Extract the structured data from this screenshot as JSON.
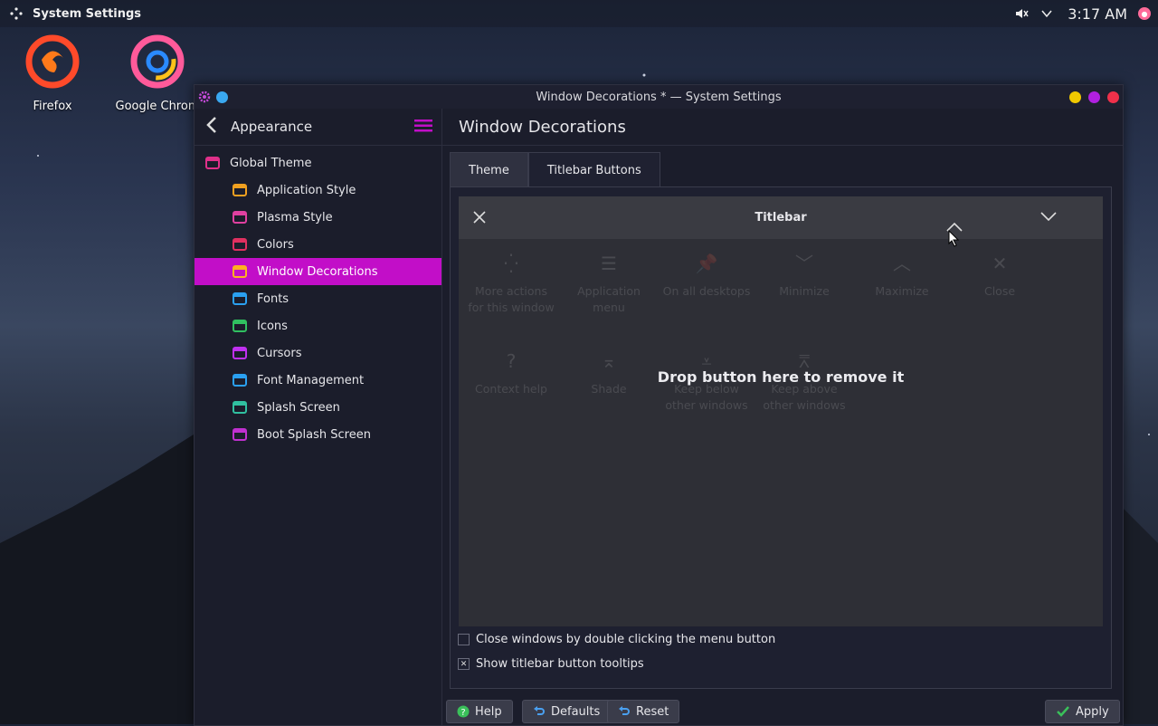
{
  "topbar": {
    "app_title": "System Settings",
    "clock": "3:17 AM"
  },
  "desktop": {
    "icons": [
      {
        "label": "Firefox",
        "icon": "firefox-icon"
      },
      {
        "label": "Google Chrom",
        "icon": "chrome-icon"
      }
    ]
  },
  "window": {
    "title": "Window Decorations * — System Settings"
  },
  "sidebar": {
    "header": "Appearance",
    "items": [
      {
        "label": "Global Theme",
        "icon": "global-theme-icon",
        "level": 0
      },
      {
        "label": "Application Style",
        "icon": "application-style-icon",
        "level": 1
      },
      {
        "label": "Plasma Style",
        "icon": "plasma-style-icon",
        "level": 1
      },
      {
        "label": "Colors",
        "icon": "colors-icon",
        "level": 1
      },
      {
        "label": "Window Decorations",
        "icon": "window-decorations-icon",
        "level": 1,
        "active": true
      },
      {
        "label": "Fonts",
        "icon": "fonts-icon",
        "level": 1
      },
      {
        "label": "Icons",
        "icon": "icons-icon",
        "level": 1
      },
      {
        "label": "Cursors",
        "icon": "cursors-icon",
        "level": 1
      },
      {
        "label": "Font Management",
        "icon": "font-management-icon",
        "level": 1
      },
      {
        "label": "Splash Screen",
        "icon": "splash-screen-icon",
        "level": 1
      },
      {
        "label": "Boot Splash Screen",
        "icon": "boot-splash-icon",
        "level": 1
      }
    ]
  },
  "main": {
    "title": "Window Decorations",
    "tabs": [
      {
        "label": "Theme"
      },
      {
        "label": "Titlebar Buttons",
        "active": true
      }
    ],
    "preview": {
      "titlebar_label": "Titlebar",
      "drop_message": "Drop button here to remove it",
      "available_buttons": [
        {
          "label": "More actions for this window",
          "icon": "more-actions-icon"
        },
        {
          "label": "Application menu",
          "icon": "app-menu-icon"
        },
        {
          "label": "On all desktops",
          "icon": "pin-icon"
        },
        {
          "label": "Minimize",
          "icon": "minimize-icon"
        },
        {
          "label": "Maximize",
          "icon": "maximize-icon"
        },
        {
          "label": "Close",
          "icon": "close-icon"
        },
        {
          "label": "Context help",
          "icon": "help-icon"
        },
        {
          "label": "Shade",
          "icon": "shade-icon"
        },
        {
          "label": "Keep below other windows",
          "icon": "keep-below-icon"
        },
        {
          "label": "Keep above other windows",
          "icon": "keep-above-icon"
        }
      ]
    },
    "options": [
      {
        "label": "Close windows by double clicking the menu button",
        "checked": false
      },
      {
        "label": "Show titlebar button tooltips",
        "checked": true
      }
    ]
  },
  "footer": {
    "help": "Help",
    "defaults": "Defaults",
    "reset": "Reset",
    "apply": "Apply"
  },
  "colors": {
    "accent": "#c20ec8",
    "tab_underline": "#3a8fd8",
    "window_bg": "#1b1d2b"
  }
}
